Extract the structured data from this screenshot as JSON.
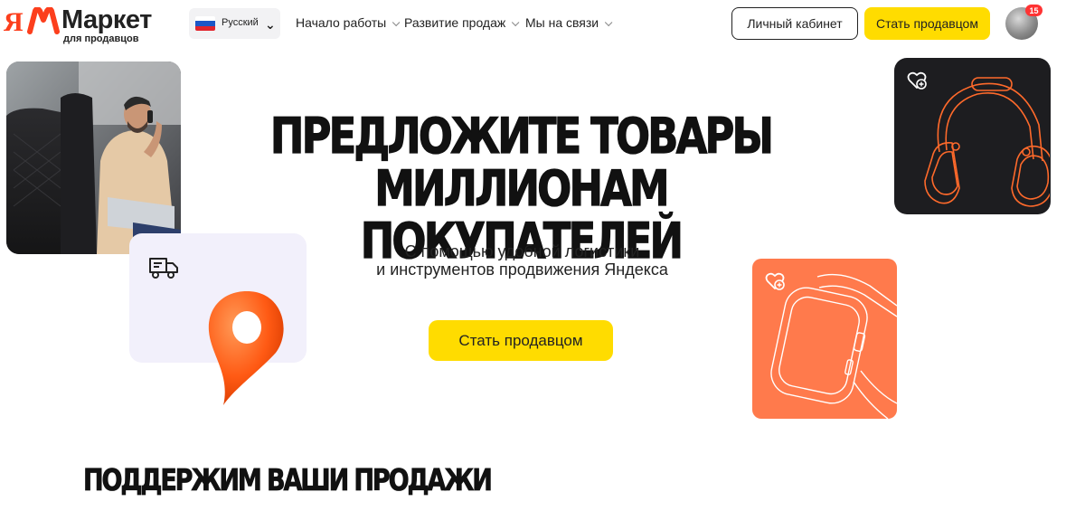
{
  "header": {
    "logo": {
      "ya": "Я",
      "title": "Маркет",
      "subtitle": "для продавцов",
      "icon": "market-logo-icon"
    },
    "language": {
      "label": "Русский",
      "flag_colors": [
        "#ffffff",
        "#1c57c7",
        "#e1242c"
      ],
      "icon": "chevron-down-icon"
    },
    "nav": [
      {
        "label": "Начало работы",
        "icon": "chevron-down-icon"
      },
      {
        "label": "Развитие продаж",
        "icon": "chevron-down-icon"
      },
      {
        "label": "Мы на связи",
        "icon": "chevron-down-icon"
      }
    ],
    "cabinet_label": "Личный кабинет",
    "seller_label": "Стать продавцом",
    "notification_count": "15"
  },
  "hero": {
    "title_line1": "ПРЕДЛОЖИТЕ ТОВАРЫ",
    "title_line2": "МИЛЛИОНАМ ПОКУПАТЕЛЕЙ",
    "subtitle_line1": "С помощью удобной логистики",
    "subtitle_line2": "и инструментов продвижения Яндекса",
    "cta_label": "Стать продавцом",
    "cards": {
      "photo": "man-on-phone-in-car-photo",
      "logistics": {
        "icons": [
          "truck-icon",
          "location-pin-icon"
        ],
        "background": "#f2f0fb"
      },
      "headphones": {
        "icons": [
          "heart-add-icon",
          "headphones-icon"
        ],
        "background": "#1d1d20",
        "accent": "#ff6a2b"
      },
      "watch": {
        "icons": [
          "heart-add-icon",
          "smartwatch-icon"
        ],
        "background": "#ff7a4c"
      }
    }
  },
  "section": {
    "title": "ПОДДЕРЖИМ ВАШИ ПРОДАЖИ"
  },
  "colors": {
    "brand_yellow": "#ffdc00",
    "brand_red": "#fc3f1d",
    "text": "#1a1a1a"
  }
}
